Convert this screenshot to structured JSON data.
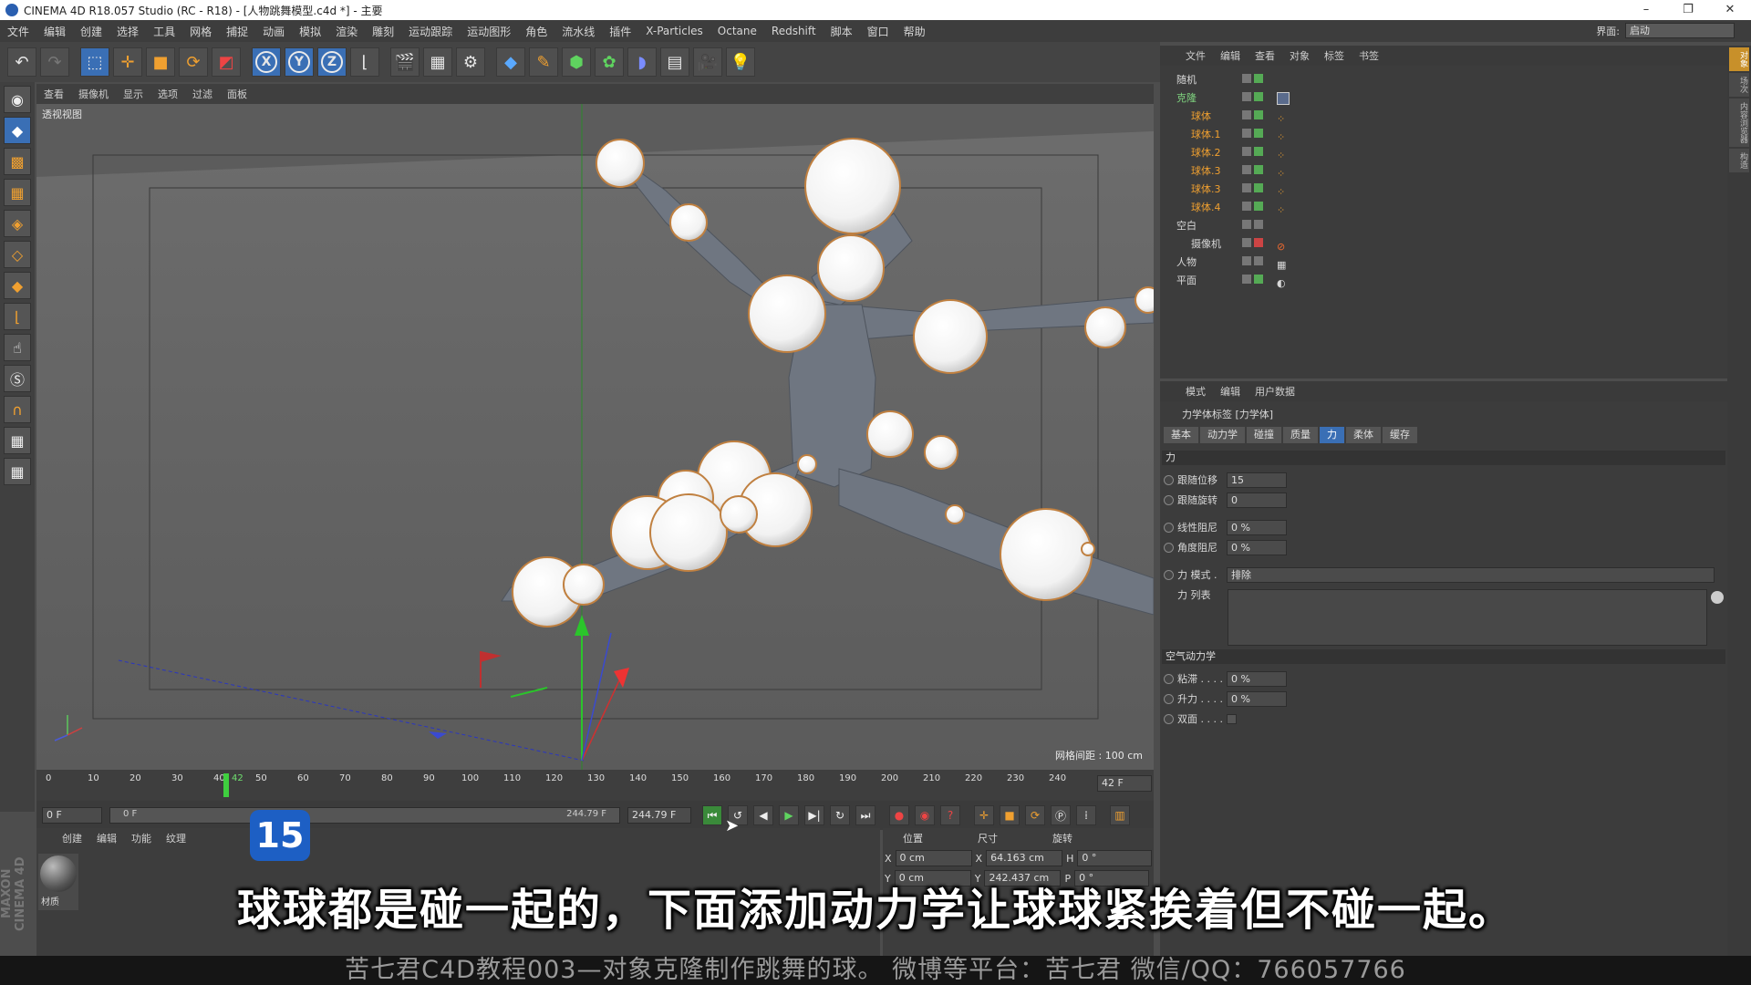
{
  "window": {
    "title": "CINEMA 4D R18.057 Studio (RC - R18) - [人物跳舞模型.c4d *] - 主要",
    "controls": [
      "–",
      "❐",
      "✕"
    ]
  },
  "menubar": {
    "items": [
      "文件",
      "编辑",
      "创建",
      "选择",
      "工具",
      "网格",
      "捕捉",
      "动画",
      "模拟",
      "渲染",
      "雕刻",
      "运动跟踪",
      "运动图形",
      "角色",
      "流水线",
      "插件",
      "X-Particles",
      "Octane",
      "Redshift",
      "脚本",
      "窗口",
      "帮助"
    ],
    "layout_label": "界面:",
    "layout_value": "启动"
  },
  "viewport": {
    "menu": [
      "查看",
      "摄像机",
      "显示",
      "选项",
      "过滤",
      "面板"
    ],
    "label": "透视视图",
    "grid_spacing": "网格间距 : 100 cm"
  },
  "timeline": {
    "ticks": [
      "0",
      "10",
      "20",
      "30",
      "40",
      "42",
      "50",
      "60",
      "70",
      "80",
      "90",
      "100",
      "110",
      "120",
      "130",
      "140",
      "150",
      "160",
      "170",
      "180",
      "190",
      "200",
      "210",
      "220",
      "230",
      "240"
    ],
    "current_frame": "42 F",
    "start": "0 F",
    "range_start": "0 F",
    "range_end": "244.79 F",
    "end": "244.79 F"
  },
  "material": {
    "menu": [
      "创建",
      "编辑",
      "功能",
      "纹理"
    ],
    "item_label": "材质"
  },
  "coords": {
    "headers": [
      "位置",
      "尺寸",
      "旋转"
    ],
    "row1": {
      "axis1": "X",
      "pos": "0 cm",
      "axis2": "X",
      "size": "64.163 cm",
      "axis3": "H",
      "rot": "0 °"
    },
    "row2": {
      "axis1": "Y",
      "pos": "0 cm",
      "axis2": "Y",
      "size": "242.437 cm",
      "axis3": "P",
      "rot": "0 °"
    }
  },
  "objects": {
    "menu": [
      "文件",
      "编辑",
      "查看",
      "对象",
      "标签",
      "书签"
    ],
    "rows": [
      {
        "name": "随机",
        "indent": 0
      },
      {
        "name": "克隆",
        "indent": 0
      },
      {
        "name": "球体",
        "indent": 1
      },
      {
        "name": "球体.1",
        "indent": 1
      },
      {
        "name": "球体.2",
        "indent": 1
      },
      {
        "name": "球体.3",
        "indent": 1
      },
      {
        "name": "球体.3",
        "indent": 1
      },
      {
        "name": "球体.4",
        "indent": 1
      },
      {
        "name": "空白",
        "indent": 0
      },
      {
        "name": "摄像机",
        "indent": 1
      },
      {
        "name": "人物",
        "indent": 0
      },
      {
        "name": "平面",
        "indent": 0
      }
    ]
  },
  "attributes": {
    "menu": [
      "模式",
      "编辑",
      "用户数据"
    ],
    "header": "力学体标签 [力学体]",
    "tabs": [
      "基本",
      "动力学",
      "碰撞",
      "质量",
      "力",
      "柔体",
      "缓存"
    ],
    "active_tab": "力",
    "section_force": "力",
    "follow_pos_label": "跟随位移",
    "follow_pos_value": "15",
    "follow_rot_label": "跟随旋转",
    "follow_rot_value": "0",
    "linear_damp_label": "线性阻尼",
    "linear_damp_value": "0 %",
    "angular_damp_label": "角度阻尼",
    "angular_damp_value": "0 %",
    "force_mode_label": "力 模式 .",
    "force_mode_value": "排除",
    "force_list_label": "力 列表",
    "section_aero": "空气动力学",
    "drag_label": "粘滞 . . . .",
    "drag_value": "0 %",
    "lift_label": "升力 . . . .",
    "lift_value": "0 %",
    "double_label": "双面 . . . ."
  },
  "right_strip": [
    "对象",
    "场次",
    "内容浏览器",
    "构造"
  ],
  "overlay": {
    "step_badge": "15",
    "subtitle": "球球都是碰一起的，下面添加动力学让球球紧挨着但不碰一起。",
    "footer": "苦七君C4D教程003—对象克隆制作跳舞的球。   微博等平台：苦七君   微信/QQ：766057766",
    "maxon": "MAXON CINEMA 4D"
  }
}
